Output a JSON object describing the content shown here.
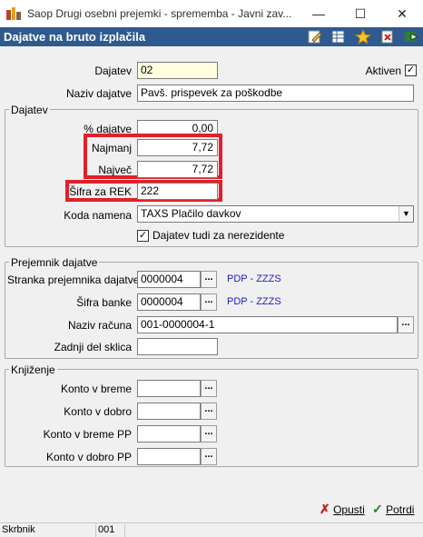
{
  "window": {
    "title": "Saop   Drugi osebni prejemki  - sprememba - Javni zav...",
    "minimize_glyph": "—",
    "maximize_glyph": "☐",
    "close_glyph": "✕"
  },
  "header": {
    "title": "Dajatve na bruto izplačila",
    "icons": [
      "edit-icon",
      "table-settings-icon",
      "star-icon",
      "delete-icon",
      "export-icon"
    ]
  },
  "top": {
    "dajatev_label": "Dajatev",
    "dajatev_value": "02",
    "aktiven_label": "Aktiven",
    "aktiven_checked": "✓",
    "naziv_label": "Naziv dajatve",
    "naziv_value": "Pavš. prispevek za poškodbe"
  },
  "dajatev_group": {
    "title": "Dajatev",
    "percent_label": "% dajatve",
    "percent_value": "0,00",
    "najmanj_label": "Najmanj",
    "najmanj_value": "7,72",
    "najvec_label": "Največ",
    "najvec_value": "7,72",
    "sifra_rek_label": "Šifra za REK",
    "sifra_rek_value": "222",
    "koda_label": "Koda namena",
    "koda_value": "TAXS Plačilo davkov",
    "nerezidenti_label": "Dajatev tudi za nerezidente",
    "nerezidenti_checked": "✓"
  },
  "prejemnik_group": {
    "title": "Prejemnik dajatve",
    "stranka_label": "Stranka prejemnika dajatve",
    "stranka_value": "0000004",
    "stranka_link": "PDP - ZZZS",
    "banka_label": "Šifra banke",
    "banka_value": "0000004",
    "banka_link": "PDP - ZZZS",
    "racun_label": "Naziv računa",
    "racun_value": "001-0000004-1",
    "sklic_label": "Zadnji del sklica",
    "sklic_value": "",
    "dots": "..."
  },
  "knjizenje_group": {
    "title": "Knjiženje",
    "breme_label": "Konto v breme",
    "dobro_label": "Konto v dobro",
    "breme_pp_label": "Konto v breme PP",
    "dobro_pp_label": "Konto v dobro PP"
  },
  "actions": {
    "cancel_label": "Opusti",
    "confirm_label": "Potrdi",
    "cancel_glyph": "✗",
    "confirm_glyph": "✓"
  },
  "status": {
    "user": "Skrbnik",
    "code": "001"
  },
  "colors": {
    "header_bg": "#2f5a8f",
    "highlight": "#e0202a",
    "link": "#2020c0"
  }
}
